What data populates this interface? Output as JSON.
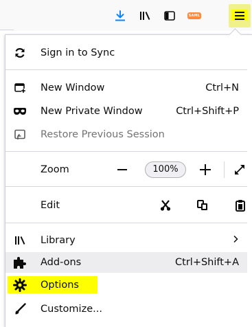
{
  "toolbar": {
    "icons": [
      "download-icon",
      "library-icon",
      "sidebar-icon",
      "extension-badge-icon",
      "hamburger-menu-icon"
    ],
    "extension_badge_text": "SAML",
    "download_color": "#0a84ff",
    "extension_color": "#ff8a3d",
    "highlight_color": "#ffff00"
  },
  "menu": {
    "sync": {
      "label": "Sign in to Sync",
      "icon": "sync-icon"
    },
    "new_window": {
      "label": "New Window",
      "shortcut": "Ctrl+N",
      "icon": "new-window-icon"
    },
    "private_window": {
      "label": "New Private Window",
      "shortcut": "Ctrl+Shift+P",
      "icon": "private-mask-icon"
    },
    "restore_session": {
      "label": "Restore Previous Session",
      "icon": "restore-session-icon"
    },
    "zoom": {
      "label": "Zoom",
      "minus": "−",
      "value": "100%",
      "plus": "+"
    },
    "edit": {
      "label": "Edit"
    },
    "library": {
      "label": "Library",
      "icon": "library-icon"
    },
    "addons": {
      "label": "Add-ons",
      "shortcut": "Ctrl+Shift+A",
      "icon": "puzzle-icon"
    },
    "options": {
      "label": "Options",
      "icon": "gear-icon"
    },
    "customize": {
      "label": "Customize...",
      "icon": "brush-icon"
    }
  }
}
